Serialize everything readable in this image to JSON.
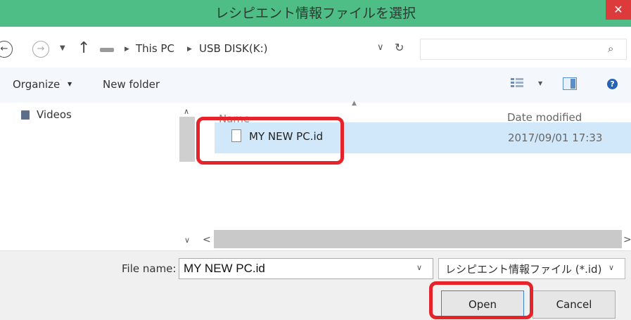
{
  "window": {
    "title": "レシピエント情報ファイルを選択",
    "close_glyph": "✕"
  },
  "nav": {
    "back_glyph": "←",
    "forward_glyph": "→",
    "history_dropdown_glyph": "▼",
    "up_glyph": "↑"
  },
  "address": {
    "separator": "▶",
    "crumbs": [
      "This PC",
      "USB DISK(K:)"
    ],
    "dropdown_glyph": "∨",
    "refresh_glyph": "↻"
  },
  "search": {
    "placeholder": "",
    "icon_glyph": "⌕"
  },
  "toolbar": {
    "organize_label": "Organize",
    "organize_dropdown": "▼",
    "new_folder_label": "New folder",
    "view_dropdown": "▼",
    "help_glyph": "?"
  },
  "sidebar": {
    "items": [
      {
        "label": "Videos",
        "icon": "videos-icon"
      }
    ],
    "scroll_up": "∧",
    "scroll_down": "∨"
  },
  "file_list": {
    "columns": {
      "name": "Name",
      "date": "Date modified",
      "sort_indicator": "▲"
    },
    "rows": [
      {
        "name": "MY NEW PC.id",
        "date_modified": "2017/09/01 17:33",
        "selected": true
      }
    ],
    "hscroll_left": "<",
    "hscroll_right": ">"
  },
  "bottom": {
    "file_name_label": "File name:",
    "file_name_value": "MY NEW PC.id",
    "file_name_dropdown": "∨",
    "file_type": "レシピエント情報ファイル (*.id)",
    "file_type_dropdown": "∨",
    "open_label": "Open",
    "cancel_label": "Cancel"
  },
  "colors": {
    "title_bar": "#4fbe86",
    "close_button": "#dd3b3b",
    "selection": "#d1e8fa",
    "highlight_box": "#e4232b"
  }
}
